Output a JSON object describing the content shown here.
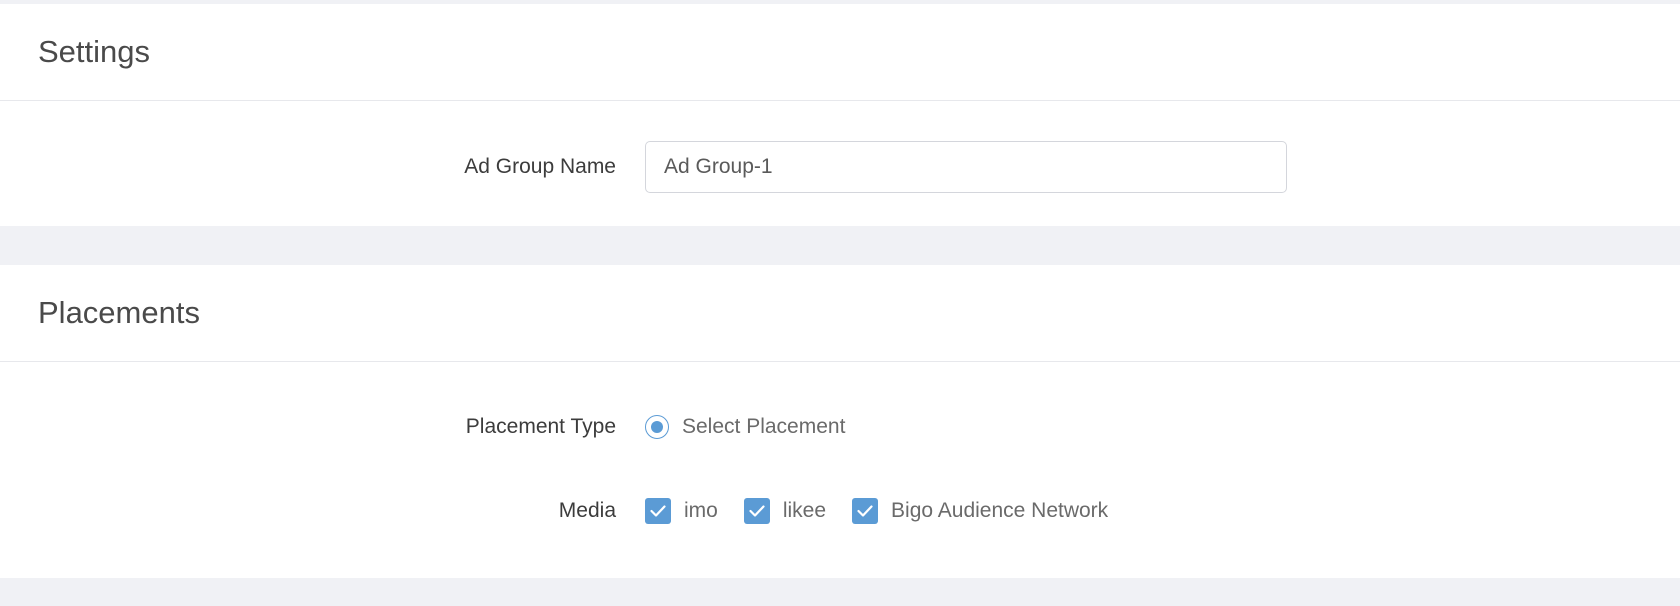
{
  "settings": {
    "title": "Settings",
    "ad_group_name": {
      "label": "Ad Group Name",
      "value": "Ad Group-1"
    }
  },
  "placements": {
    "title": "Placements",
    "placement_type": {
      "label": "Placement Type",
      "selected_option": "Select Placement"
    },
    "media": {
      "label": "Media",
      "options": [
        {
          "label": "imo",
          "checked": true
        },
        {
          "label": "likee",
          "checked": true
        },
        {
          "label": "Bigo Audience Network",
          "checked": true
        }
      ]
    }
  },
  "theme": {
    "accent": "#5b9bd5",
    "background": "#f0f1f5"
  }
}
